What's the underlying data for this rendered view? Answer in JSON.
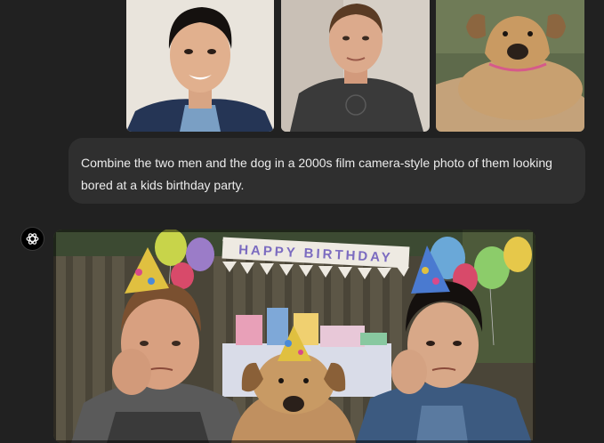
{
  "conversation": {
    "user_message": {
      "text": "Combine the two men and the dog in a 2000s film camera-style photo of them looking bored at a kids birthday party.",
      "attachments": [
        {
          "icon": "photo-man-smiling"
        },
        {
          "icon": "photo-man-gray-shirt"
        },
        {
          "icon": "photo-dog"
        }
      ]
    },
    "assistant_message": {
      "avatar_icon": "openai-logo-icon",
      "generated_image": {
        "banner_text": "HAPPY BIRTHDAY"
      }
    }
  },
  "colors": {
    "background": "#212121",
    "user_bubble": "#2f2f2f",
    "text": "#ececec"
  }
}
